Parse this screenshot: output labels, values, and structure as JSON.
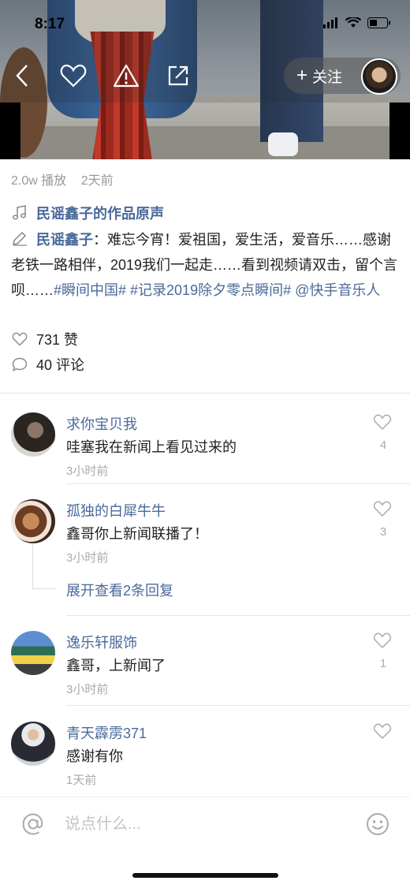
{
  "status_bar": {
    "time": "8:17"
  },
  "topbar": {
    "back_icon": "chevron-left-icon",
    "like_icon": "heart-outline-icon",
    "report_icon": "warning-triangle-icon",
    "share_icon": "share-external-icon",
    "follow_label": "关注"
  },
  "video_info": {
    "plays": "2.0w 播放",
    "posted": "2天前",
    "song": "民谣鑫子的作品原声",
    "author": "民谣鑫子",
    "caption_text": "：难忘今宵！爱祖国，爱生活，爱音乐……感谢老铁一路相伴，2019我们一起走……看到视频请双击，留个言呗……",
    "tags": "#瞬间中国# #记录2019除夕零点瞬间#",
    "mention": "@快手音乐人",
    "likes": "731 赞",
    "comments": "40 评论"
  },
  "comments": [
    {
      "name": "求你宝贝我",
      "text": "哇塞我在新闻上看见过来的",
      "time": "3小时前",
      "likes": "4"
    },
    {
      "name": "孤独的白犀牛牛",
      "text": "鑫哥你上新闻联播了！",
      "time": "3小时前",
      "likes": "3"
    },
    {
      "name": "逸乐轩服饰",
      "text": "鑫哥，上新闻了",
      "time": "3小时前",
      "likes": "1"
    },
    {
      "name": "青天霹雳371",
      "text": "感谢有你",
      "time": "1天前",
      "likes": ""
    }
  ],
  "replies_label": "展开查看2条回复",
  "input": {
    "placeholder": "说点什么..."
  },
  "colors": {
    "link": "#4a6a9a",
    "muted": "#999999"
  }
}
